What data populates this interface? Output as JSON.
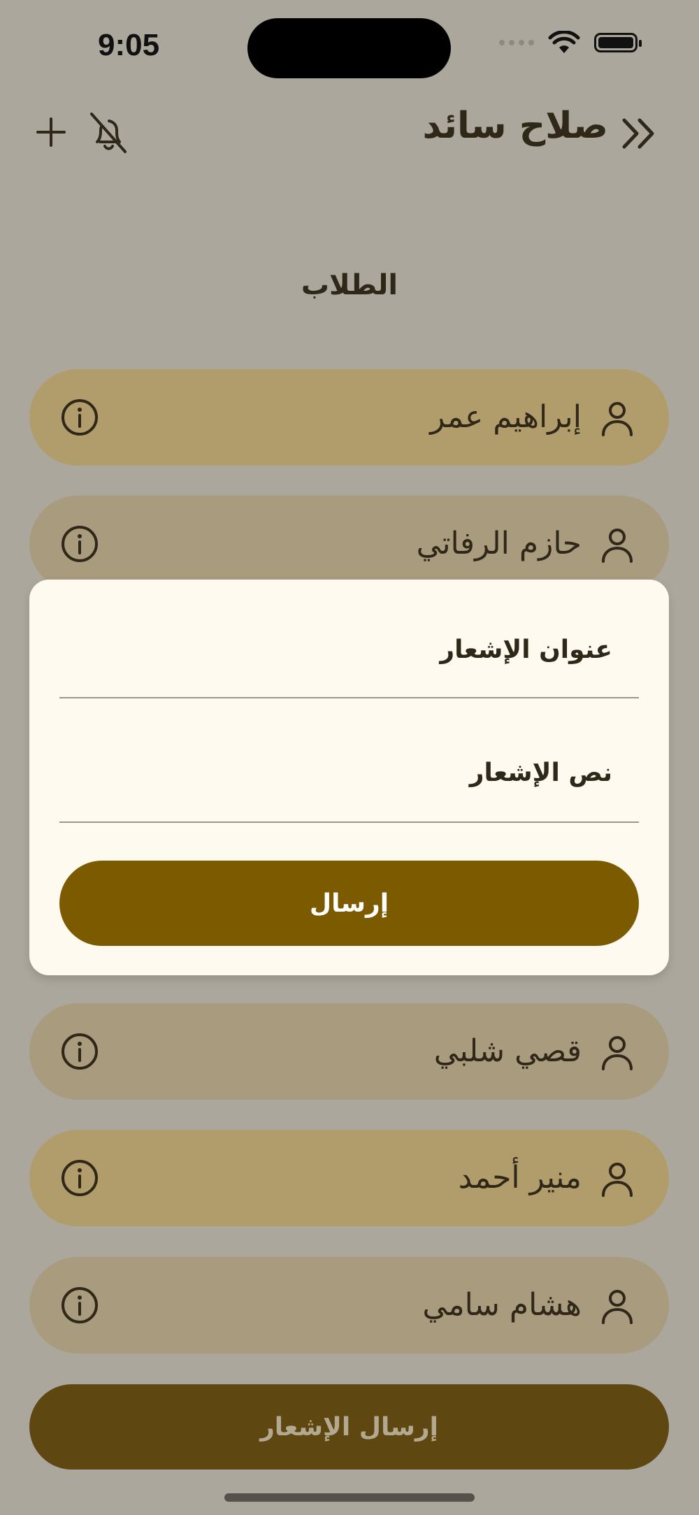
{
  "status_bar": {
    "time": "9:05"
  },
  "header": {
    "title": "صلاح سائد",
    "icons": {
      "back": "double-chevron-icon",
      "notifications_off": "bell-off-icon",
      "add": "plus-icon"
    }
  },
  "section_title": "الطلاب",
  "students": [
    {
      "name": "إبراهيم عمر",
      "color": "#b19c6b"
    },
    {
      "name": "حازم الرفاتي",
      "color": "#a99b7e"
    },
    {
      "name": "قصي شلبي",
      "color": "#a99b7e"
    },
    {
      "name": "منير أحمد",
      "color": "#b19c6b"
    },
    {
      "name": "هشام سامي",
      "color": "#a99b7e"
    }
  ],
  "notification_dialog": {
    "title_label": "عنوان الإشعار",
    "body_label": "نص الإشعار",
    "send_label": "إرسال"
  },
  "bottom_action": {
    "label": "إرسال الإشعار"
  },
  "colors": {
    "background": "#aca79d",
    "primary": "#7c5a00",
    "dialog_bg": "#fefaef"
  }
}
